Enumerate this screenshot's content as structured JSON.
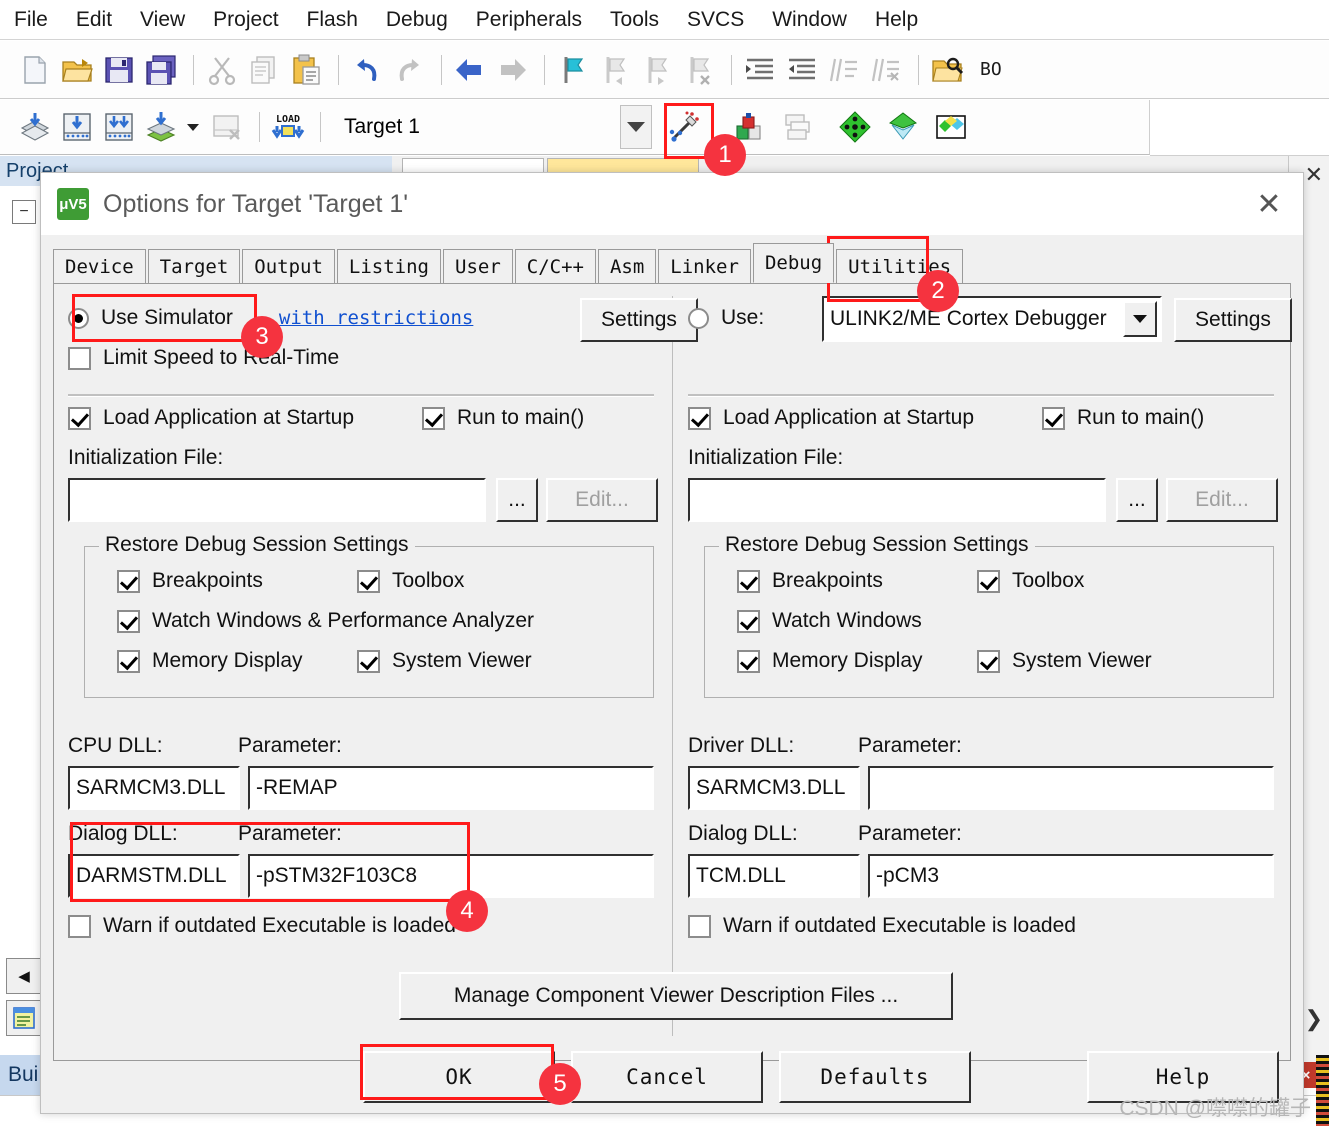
{
  "app": {
    "menu": [
      "File",
      "Edit",
      "View",
      "Project",
      "Flash",
      "Debug",
      "Peripherals",
      "Tools",
      "SVCS",
      "Window",
      "Help"
    ],
    "toolbar_target": "Target 1",
    "toolbar_bo_label": "BO",
    "project_panel_title": "Project",
    "build_tab_label": "Bui"
  },
  "dialog": {
    "title": "Options for Target 'Target 1'",
    "logo_text": "μV5",
    "close_glyph": "✕",
    "tabs": [
      {
        "label": "Device",
        "active": false
      },
      {
        "label": "Target",
        "active": false
      },
      {
        "label": "Output",
        "active": false
      },
      {
        "label": "Listing",
        "active": false
      },
      {
        "label": "User",
        "active": false
      },
      {
        "label": "C/C++",
        "active": false
      },
      {
        "label": "Asm",
        "active": false
      },
      {
        "label": "Linker",
        "active": false
      },
      {
        "label": "Debug",
        "active": true
      },
      {
        "label": "Utilities",
        "active": false
      }
    ],
    "left": {
      "use_simulator_label": "Use Simulator",
      "use_simulator_checked": true,
      "restrictions_link": "with restrictions",
      "settings_button": "Settings",
      "limit_speed_label": "Limit Speed to Real-Time",
      "limit_speed_checked": false,
      "load_app_label": "Load Application at Startup",
      "load_app_checked": true,
      "run_to_main_label": "Run to main()",
      "run_to_main_checked": true,
      "init_file_label": "Initialization File:",
      "init_file_value": "",
      "browse_button": "...",
      "edit_button": "Edit...",
      "restore_group_label": "Restore Debug Session Settings",
      "restore_items": [
        {
          "label": "Breakpoints",
          "checked": true
        },
        {
          "label": "Toolbox",
          "checked": true
        },
        {
          "label": "Watch Windows & Performance Analyzer",
          "checked": true
        },
        {
          "label": "Memory Display",
          "checked": true
        },
        {
          "label": "System Viewer",
          "checked": true
        }
      ],
      "dll_label": "CPU DLL:",
      "dll_param_label": "Parameter:",
      "dll_value": "SARMCM3.DLL",
      "dll_param_value": "-REMAP",
      "dialog_dll_label": "Dialog DLL:",
      "dialog_dll_param_label": "Parameter:",
      "dialog_dll_value": "DARMSTM.DLL",
      "dialog_dll_param_value": "-pSTM32F103C8",
      "warn_label": "Warn if outdated Executable is loaded",
      "warn_checked": false
    },
    "right": {
      "use_label": "Use:",
      "use_checked": false,
      "debugger_selected": "ULINK2/ME Cortex Debugger",
      "settings_button": "Settings",
      "load_app_label": "Load Application at Startup",
      "load_app_checked": true,
      "run_to_main_label": "Run to main()",
      "run_to_main_checked": true,
      "init_file_label": "Initialization File:",
      "init_file_value": "",
      "browse_button": "...",
      "edit_button": "Edit...",
      "restore_group_label": "Restore Debug Session Settings",
      "restore_items": [
        {
          "label": "Breakpoints",
          "checked": true
        },
        {
          "label": "Toolbox",
          "checked": true
        },
        {
          "label": "Watch Windows",
          "checked": true
        },
        {
          "label": "Memory Display",
          "checked": true
        },
        {
          "label": "System Viewer",
          "checked": true
        }
      ],
      "dll_label": "Driver DLL:",
      "dll_param_label": "Parameter:",
      "dll_value": "SARMCM3.DLL",
      "dll_param_value": "",
      "dialog_dll_label": "Dialog DLL:",
      "dialog_dll_param_label": "Parameter:",
      "dialog_dll_value": "TCM.DLL",
      "dialog_dll_param_value": "-pCM3",
      "warn_label": "Warn if outdated Executable is loaded",
      "warn_checked": false
    },
    "manage_button": "Manage Component Viewer Description Files ...",
    "footer": {
      "ok": "OK",
      "cancel": "Cancel",
      "defaults": "Defaults",
      "help": "Help"
    }
  },
  "callouts": [
    {
      "id": "1",
      "num": "1"
    },
    {
      "id": "2",
      "num": "2"
    },
    {
      "id": "3",
      "num": "3"
    },
    {
      "id": "4",
      "num": "4"
    },
    {
      "id": "5",
      "num": "5"
    }
  ],
  "watermark": "CSDN @噤噤的罐子",
  "colors": {
    "accent_red": "#f5333f",
    "link_blue": "#1050d0",
    "dialog_bg": "#f0f0f0",
    "title_gray": "#5a5a5a"
  }
}
